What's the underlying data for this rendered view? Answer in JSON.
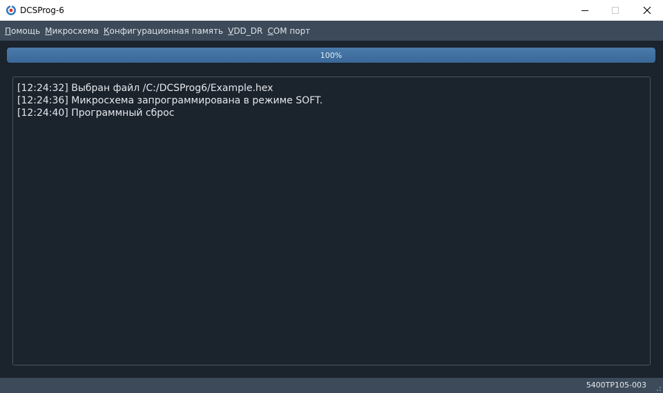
{
  "window": {
    "title": "DCSProg-6",
    "icon": "dcsprog-app-icon"
  },
  "menu": [
    {
      "accel": "П",
      "rest": "омощь"
    },
    {
      "accel": "М",
      "rest": "икросхема"
    },
    {
      "accel": "К",
      "rest": "онфигурационная память"
    },
    {
      "accel": "V",
      "rest": "DD_DR"
    },
    {
      "accel": "C",
      "rest": "OM порт"
    }
  ],
  "progress": {
    "value": 100,
    "label": "100%"
  },
  "log": [
    "[12:24:32] Выбран файл /C:/DCSProg6/Example.hex",
    "[12:24:36] Микросхема запрограммирована в режиме SOFT.",
    "[12:24:40] Программный сброс"
  ],
  "status": {
    "device": "5400TP105-003"
  },
  "colors": {
    "background": "#1b232d",
    "menubar": "#3d4a59",
    "progress_fill": "#4a7bab"
  }
}
